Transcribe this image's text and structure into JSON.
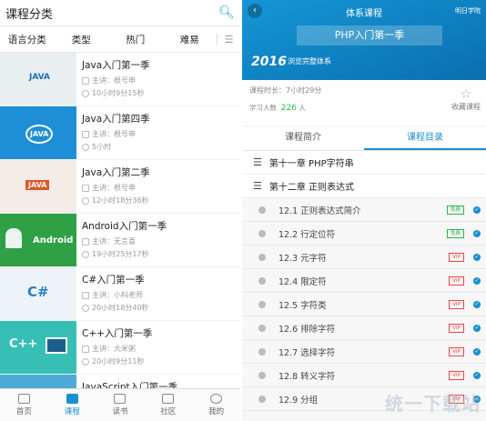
{
  "left": {
    "header_title": "课程分类",
    "filters": [
      "语言分类",
      "类型",
      "热门",
      "难易"
    ],
    "courses": [
      {
        "title": "Java入门第一季",
        "lecturer": "主讲：根号申",
        "duration": "10小时9分15秒",
        "thumb_color": "#e7ecef",
        "thumb_text": "JAVA"
      },
      {
        "title": "Java入门第四季",
        "lecturer": "主讲：根号申",
        "duration": "5小时",
        "thumb_color": "#1e8fd6",
        "thumb_text": "JAVA"
      },
      {
        "title": "Java入门第二季",
        "lecturer": "主讲：根号申",
        "duration": "12小时18分36秒",
        "thumb_color": "#f4ece6",
        "thumb_text": "JAVA"
      },
      {
        "title": "Android入门第一季",
        "lecturer": "主讲：无言喜",
        "duration": "19小时25分17秒",
        "thumb_color": "#2fa046",
        "thumb_text": "Android"
      },
      {
        "title": "C#入门第一季",
        "lecturer": "主讲：小科老师",
        "duration": "20小时18分40秒",
        "thumb_color": "#eef3f8",
        "thumb_text": "C#"
      },
      {
        "title": "C++入门第一季",
        "lecturer": "主讲：大米粥",
        "duration": "20小时9分11秒",
        "thumb_color": "#37bfb6",
        "thumb_text": "C++"
      },
      {
        "title": "JavaScript入门第一季",
        "lecturer": "",
        "duration": "",
        "thumb_color": "#4dabd7",
        "thumb_text": ""
      }
    ],
    "tabs": [
      "首页",
      "课程",
      "读书",
      "社区",
      "我的"
    ]
  },
  "right": {
    "header_title": "体系课程",
    "brand": "明日学院",
    "banner_title": "PHP入门第一季",
    "banner_sub": "浏览完整体系",
    "year": "2016",
    "duration_text": "课程时长：7小时29分",
    "count_label": "学习人数",
    "count_value": "226",
    "count_unit": "人",
    "fav_label": "收藏课程",
    "tabs": [
      "课程简介",
      "课程目录"
    ],
    "chapters": [
      "第十一章 PHP字符串",
      "第十二章 正则表达式"
    ],
    "lessons": [
      {
        "label": "12.1 正则表达式简介",
        "badge": "免费",
        "free": true
      },
      {
        "label": "12.2 行定位符",
        "badge": "免费",
        "free": true
      },
      {
        "label": "12.3 元字符",
        "badge": "VIP",
        "free": false
      },
      {
        "label": "12.4 限定符",
        "badge": "VIP",
        "free": false
      },
      {
        "label": "12.5 字符类",
        "badge": "VIP",
        "free": false
      },
      {
        "label": "12.6 排除字符",
        "badge": "VIP",
        "free": false
      },
      {
        "label": "12.7 选择字符",
        "badge": "VIP",
        "free": false
      },
      {
        "label": "12.8 转义字符",
        "badge": "VIP",
        "free": false
      },
      {
        "label": "12.9 分组",
        "badge": "VIP",
        "free": false
      }
    ],
    "watermark": "统一下载站"
  }
}
